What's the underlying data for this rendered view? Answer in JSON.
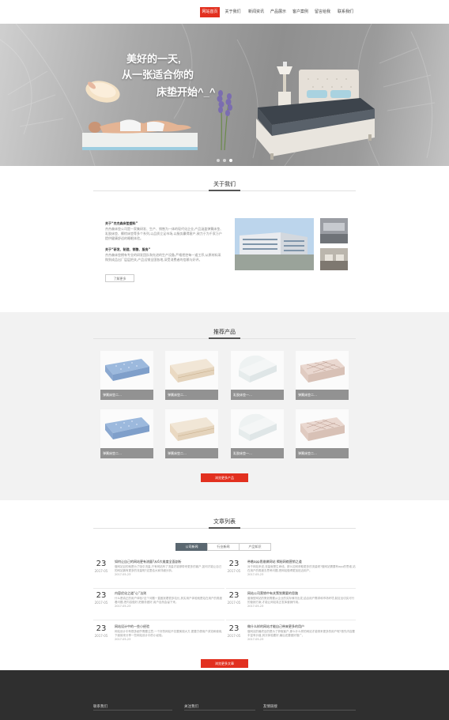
{
  "nav": {
    "items": [
      "网站首页",
      "关于我们",
      "新闻资讯",
      "产品展示",
      "客户案例",
      "留言给我",
      "联系我们"
    ],
    "active_index": 0
  },
  "hero": {
    "line1": "美好的一天,",
    "line2": "从一张适合你的",
    "line3": "床垫开始^_^",
    "slides": 3,
    "active_slide": 2
  },
  "about": {
    "title": "关于我们",
    "h1": "关于“杰杰森床垫塑料”",
    "p1": "杰杰森床垫公司是一家集研发、生产、销售为一体的现代化企业,产品涵盖弹簧床垫、乳胶床垫、椰棕床垫等多个系列,以品质立足市场,以服务赢得客户,致力于为千家万户提供健康舒适的睡眠体验。",
    "h2": "关于“研发、制造、销售、服务”",
    "p2": "杰杰森床垫拥有专业的研发团队和先进的生产设备,严格把控每一道工序,从原材料采购到成品出厂层层把关,产品远销全国各地,深受消费者的信赖与好评。",
    "more": "了解更多"
  },
  "products": {
    "title": "推荐产品",
    "items": [
      "弹簧床垫二…",
      "弹簧床垫二…",
      "乳胶床垫一…",
      "弹簧床垫二…",
      "弹簧床垫二…",
      "弹簧床垫二…",
      "乳胶床垫一…",
      "弹簧床垫二…"
    ],
    "more": "浏览更多产品"
  },
  "articles": {
    "title": "文章列表",
    "tabs": [
      "公司新闻",
      "行业新闻",
      "产品知识"
    ],
    "active_tab": 0,
    "items": [
      {
        "day": "23",
        "ym": "2017-05",
        "title": "如何让自己的网站更有流量?从6大维度全面剖析",
        "summary": "做网站目的就是为了吸引流量,只有网站有了流量才能够带来更多的客户,如何才能让自己的网站拥有更多的流量呢?这里给大家详细分析。",
        "date": "2017-05-23"
      },
      {
        "day": "23",
        "ym": "2017-05",
        "title": "带着app思维做网站 揭秘网络营销之道",
        "summary": "对于网站来说,流量就是生命线。那么如何获取更多的流量呢?做网站需要有app的思维,站在用户的角度去思考问题,把网站做得更加贴近用户。",
        "date": "2017-05-23"
      },
      {
        "day": "23",
        "ym": "2017-05",
        "title": "内容优化之道“心”法则",
        "summary": "什么是真正的用户体验?这个问题一直困扰着很多站长,其实用户体验就是站在用户的角度看问题,把内容做好,把服务做好,用户自然会留下来。",
        "date": "2017-05-23"
      },
      {
        "day": "23",
        "ym": "2017-05",
        "title": "网站公司营销中有关策划需要的思路",
        "summary": "营销型网站的策划需要从企业的实际情况出发,结合用户需求和市场环境,制定出切实可行的营销方案,才能让网站真正发挥营销作用。",
        "date": "2017-05-23"
      },
      {
        "day": "23",
        "ym": "2017-05",
        "title": "网站设计中的一些小经验",
        "summary": "网站设计中有很多细节需要注意,一个好的网站不仅要美观大方,更要方便用户浏览和使用,下面就来分享一些网站设计中的小经验。",
        "date": "2017-05-23"
      },
      {
        "day": "23",
        "ym": "2017-05",
        "title": "做什么样的网站才能自己带来更多的用户",
        "summary": "做网站的最终目的是为了获取客户,那么什么样的网站才能带来更多的用户呢?首先内容要丰富有价值,其次体验要好,最后还要做好推广。",
        "date": "2017-05-23"
      }
    ],
    "more": "浏览更多文章"
  },
  "footer": {
    "cols": [
      "联系我们",
      "关注我们",
      "友情链接"
    ]
  },
  "colors": {
    "accent": "#e2301f",
    "caption": "#929292",
    "tab_active": "#5a6770",
    "footer": "#2f2f2f"
  }
}
